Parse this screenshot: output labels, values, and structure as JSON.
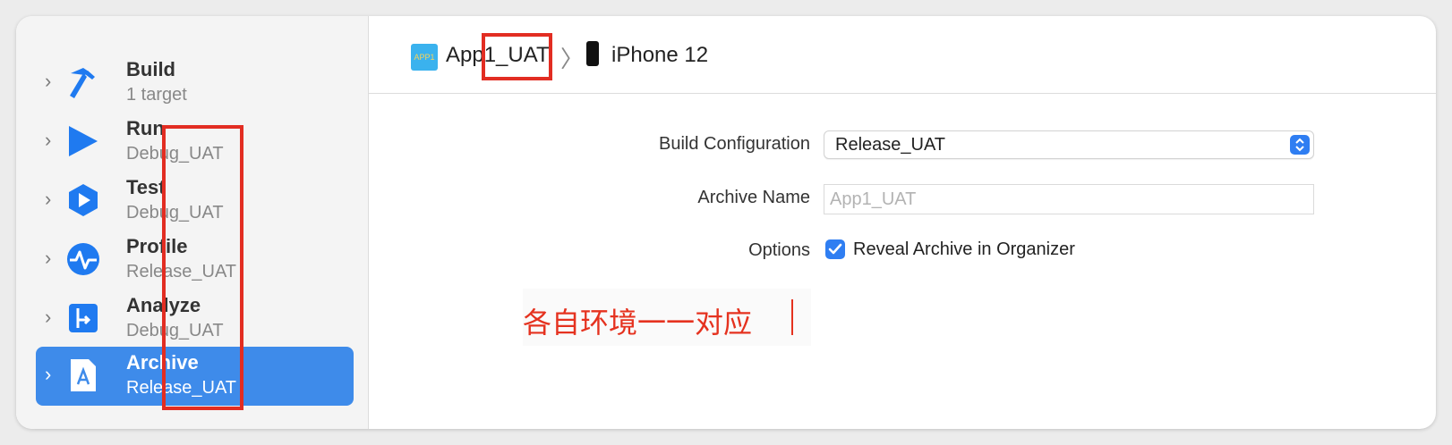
{
  "sidebar": {
    "items": [
      {
        "title": "Build",
        "subtitle": "1 target",
        "icon": "hammer-icon"
      },
      {
        "title": "Run",
        "subtitle": "Debug_UAT",
        "icon": "play-icon"
      },
      {
        "title": "Test",
        "subtitle": "Debug_UAT",
        "icon": "test-icon"
      },
      {
        "title": "Profile",
        "subtitle": "Release_UAT",
        "icon": "profile-icon"
      },
      {
        "title": "Analyze",
        "subtitle": "Debug_UAT",
        "icon": "analyze-icon"
      },
      {
        "title": "Archive",
        "subtitle": "Release_UAT",
        "icon": "archive-icon",
        "selected": true
      }
    ]
  },
  "scheme": {
    "app_icon_text": "APP1",
    "name": "App1_UAT",
    "device": "iPhone 12"
  },
  "form": {
    "build_config_label": "Build Configuration",
    "build_config_value": "Release_UAT",
    "archive_name_label": "Archive Name",
    "archive_name_placeholder": "App1_UAT",
    "options_label": "Options",
    "reveal_checkbox_label": "Reveal Archive in Organizer",
    "reveal_checked": true
  },
  "annotation": {
    "text": "各自环境一一对应",
    "color": "#e5321f"
  },
  "colors": {
    "accent": "#2f7ef2",
    "selection": "#3e8bea",
    "highlight": "#e22d22"
  }
}
